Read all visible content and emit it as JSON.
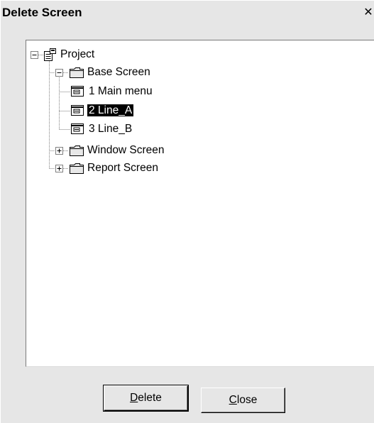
{
  "dialog": {
    "title": "Delete Screen",
    "close_glyph": "✕"
  },
  "tree": {
    "root": {
      "label": "Project",
      "icon": "project-icon",
      "expanded": true
    },
    "folders": [
      {
        "label": "Base Screen",
        "icon": "folder-icon",
        "expanded": true,
        "children": [
          {
            "label": "1 Main menu",
            "icon": "screen-icon",
            "selected": false
          },
          {
            "label": "2 Line_A",
            "icon": "screen-icon",
            "selected": true
          },
          {
            "label": "3 Line_B",
            "icon": "screen-icon",
            "selected": false
          }
        ]
      },
      {
        "label": "Window Screen",
        "icon": "folder-icon",
        "expanded": false
      },
      {
        "label": "Report Screen",
        "icon": "folder-icon",
        "expanded": false
      }
    ]
  },
  "buttons": {
    "delete": {
      "mnemonic": "D",
      "rest": "elete"
    },
    "close": {
      "mnemonic": "C",
      "rest": "lose"
    }
  }
}
